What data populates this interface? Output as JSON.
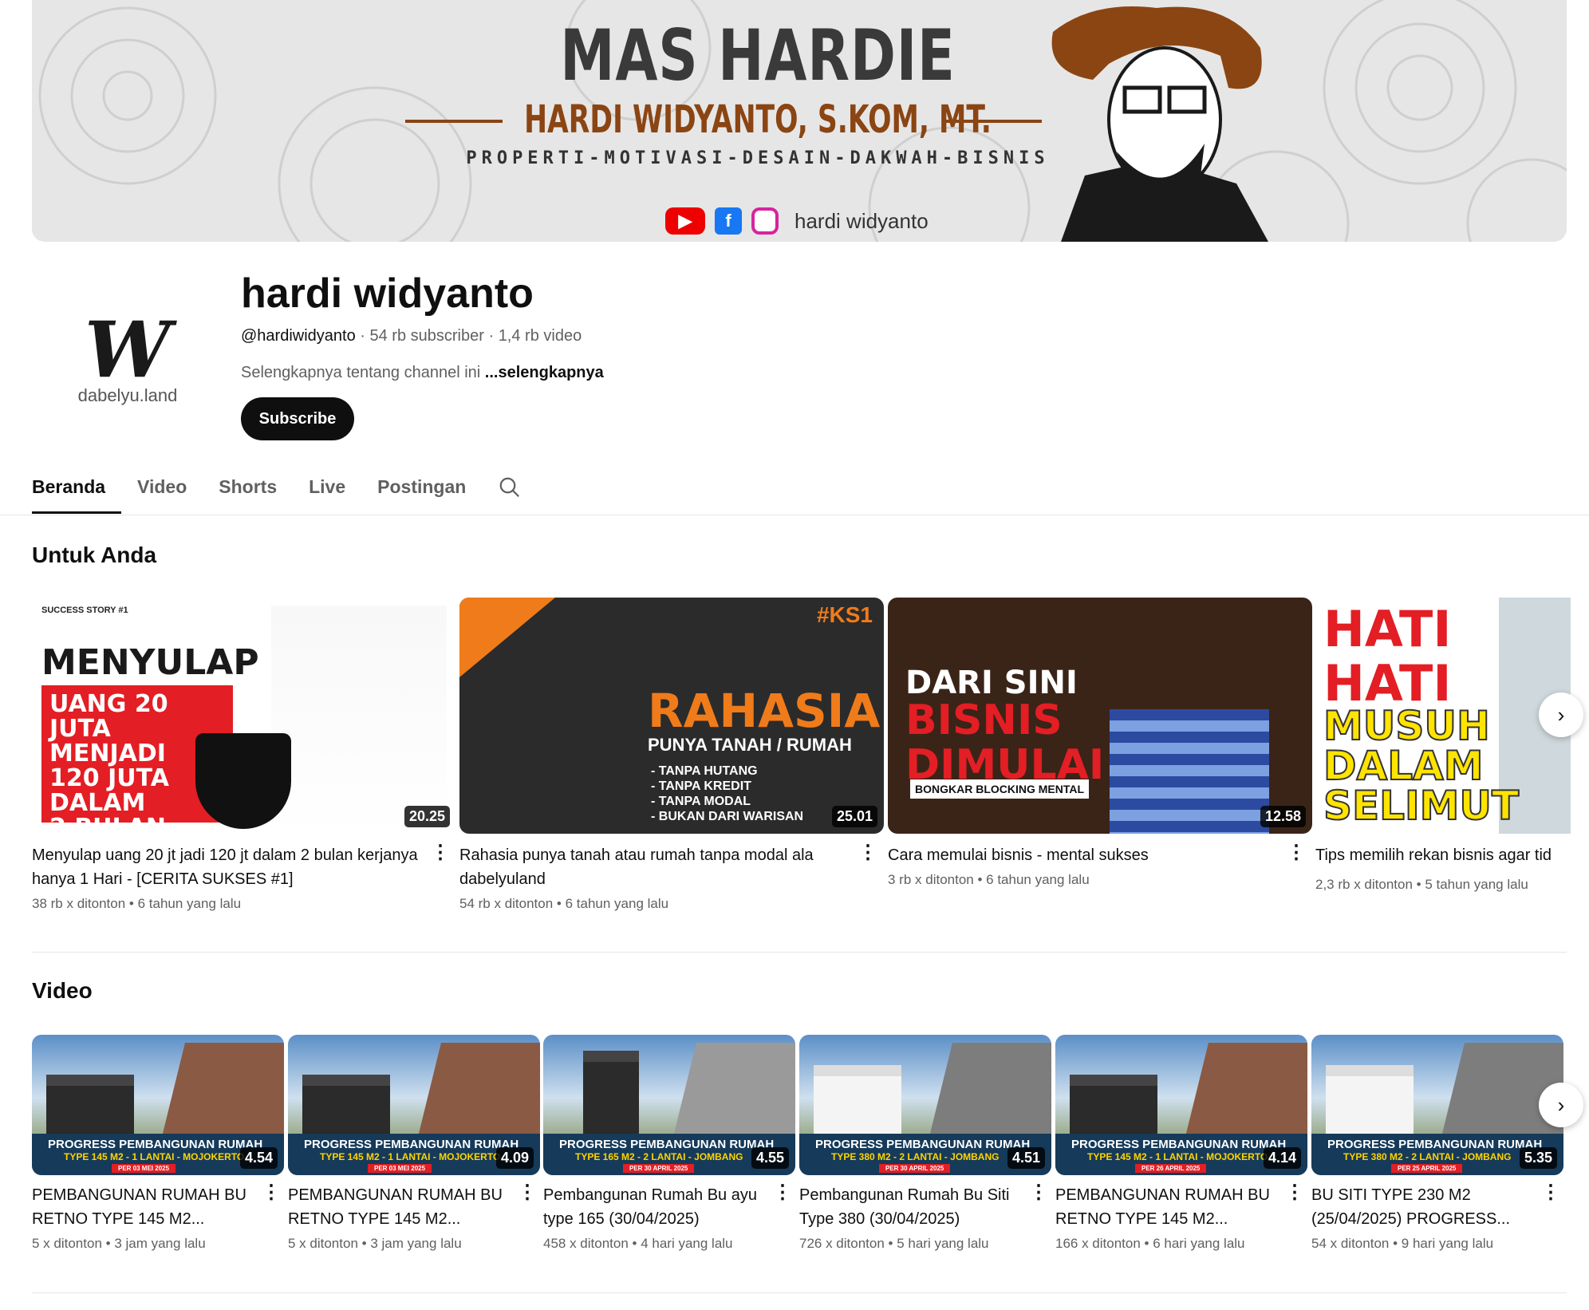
{
  "banner": {
    "title": "MAS HARDIE",
    "subtitle": "HARDI WIDYANTO, S.KOM, MT.",
    "tagline": "PROPERTI-MOTIVASI-DESAIN-DAKWAH-BISNIS",
    "handle": "hardi widyanto",
    "icons": [
      "youtube-icon",
      "facebook-icon",
      "instagram-icon"
    ]
  },
  "channel": {
    "name": "hardi widyanto",
    "handle": "@hardiwidyanto",
    "subscribers": "54 rb subscriber",
    "videos": "1,4 rb video",
    "description": "Selengkapnya tentang channel ini",
    "more_link": "...selengkapnya",
    "subscribe_label": "Subscribe",
    "avatar_text": "dabelyu.land",
    "avatar_brand": "dabel"
  },
  "tabs": [
    "Beranda",
    "Video",
    "Shorts",
    "Live",
    "Postingan"
  ],
  "active_tab": "Beranda",
  "section_for_you": {
    "title": "Untuk Anda",
    "videos": [
      {
        "title": "Menyulap uang 20 jt jadi 120 jt dalam 2 bulan kerjanya hanya 1 Hari - [CERITA SUKSES #1]",
        "views": "38 rb x ditonton",
        "age": "6 tahun yang lalu",
        "duration": "20.25",
        "thumb": {
          "story": "SUCCESS STORY #1",
          "headline": "MENYULAP",
          "lines": [
            "UANG 20 JUTA",
            "MENJADI",
            "120 JUTA",
            "DALAM",
            "2 BULAN"
          ]
        }
      },
      {
        "title": "Rahasia punya tanah atau rumah tanpa modal ala dabelyuland",
        "views": "54 rb x ditonton",
        "age": "6 tahun yang lalu",
        "duration": "25.01",
        "thumb": {
          "tag": "#KS1",
          "headline": "RAHASIA",
          "sub": "PUNYA TANAH / RUMAH",
          "list": [
            "- TANPA HUTANG",
            "- TANPA KREDIT",
            "- TANPA MODAL",
            "- BUKAN DARI WARISAN"
          ]
        }
      },
      {
        "title": "Cara memulai bisnis - mental sukses",
        "views": "3 rb x ditonton",
        "age": "6 tahun yang lalu",
        "duration": "12.58",
        "thumb": {
          "l1": "DARI SINI",
          "l2": "BISNIS",
          "l3": "DIMULAI",
          "box": "BONGKAR BLOCKING MENTAL"
        }
      },
      {
        "title": "Tips memilih rekan bisnis agar tid",
        "views": "2,3 rb x ditonton",
        "age": "5 tahun yang lalu",
        "thumb": {
          "l1": "HATI",
          "l2": "HATI",
          "l3": "MUSUH",
          "l4": "DALAM",
          "l5": "SELIMUT"
        }
      }
    ]
  },
  "section_video": {
    "title": "Video",
    "videos": [
      {
        "title": "PEMBANGUNAN RUMAH BU RETNO TYPE 145 M2...",
        "views": "5 x ditonton",
        "age": "3 jam yang lalu",
        "duration": "4.54",
        "band1": "PROGRESS PEMBANGUNAN RUMAH",
        "band2": "TYPE 145 M2 - 1 LANTAI - MOJOKERTO",
        "band3": "PER 03 MEI 2025"
      },
      {
        "title": "PEMBANGUNAN RUMAH BU RETNO TYPE 145 M2...",
        "views": "5 x ditonton",
        "age": "3 jam yang lalu",
        "duration": "4.09",
        "band1": "PROGRESS PEMBANGUNAN RUMAH",
        "band2": "TYPE 145 M2 - 1 LANTAI - MOJOKERTO",
        "band3": "PER 03 MEI 2025"
      },
      {
        "title": "Pembangunan Rumah Bu ayu type 165 (30/04/2025)",
        "views": "458 x ditonton",
        "age": "4 hari yang lalu",
        "duration": "4.55",
        "band1": "PROGRESS PEMBANGUNAN RUMAH",
        "band2": "TYPE 165 M2 - 2 LANTAI - JOMBANG",
        "band3": "PER 30 APRIL 2025"
      },
      {
        "title": "Pembangunan Rumah Bu Siti Type 380 (30/04/2025)",
        "views": "726 x ditonton",
        "age": "5 hari yang lalu",
        "duration": "4.51",
        "band1": "PROGRESS PEMBANGUNAN RUMAH",
        "band2": "TYPE 380 M2 - 2 LANTAI - JOMBANG",
        "band3": "PER 30 APRIL 2025"
      },
      {
        "title": "PEMBANGUNAN RUMAH BU RETNO TYPE 145 M2...",
        "views": "166 x ditonton",
        "age": "6 hari yang lalu",
        "duration": "4.14",
        "band1": "PROGRESS PEMBANGUNAN RUMAH",
        "band2": "TYPE 145 M2 - 1 LANTAI - MOJOKERTO",
        "band3": "PER 26 APRIL 2025"
      },
      {
        "title": "BU SITI TYPE 230 M2 (25/04/2025) PROGRESS...",
        "views": "54 x ditonton",
        "age": "9 hari yang lalu",
        "duration": "5.35",
        "band1": "PROGRESS PEMBANGUNAN RUMAH",
        "band2": "TYPE 380 M2 - 2 LANTAI - JOMBANG",
        "band3": "PER 25 APRIL 2025"
      }
    ]
  },
  "colors": {
    "accent": "#0f0f0f",
    "muted": "#606060",
    "brown": "#8b4513",
    "red": "#e31e24",
    "orange": "#f07b1a"
  }
}
